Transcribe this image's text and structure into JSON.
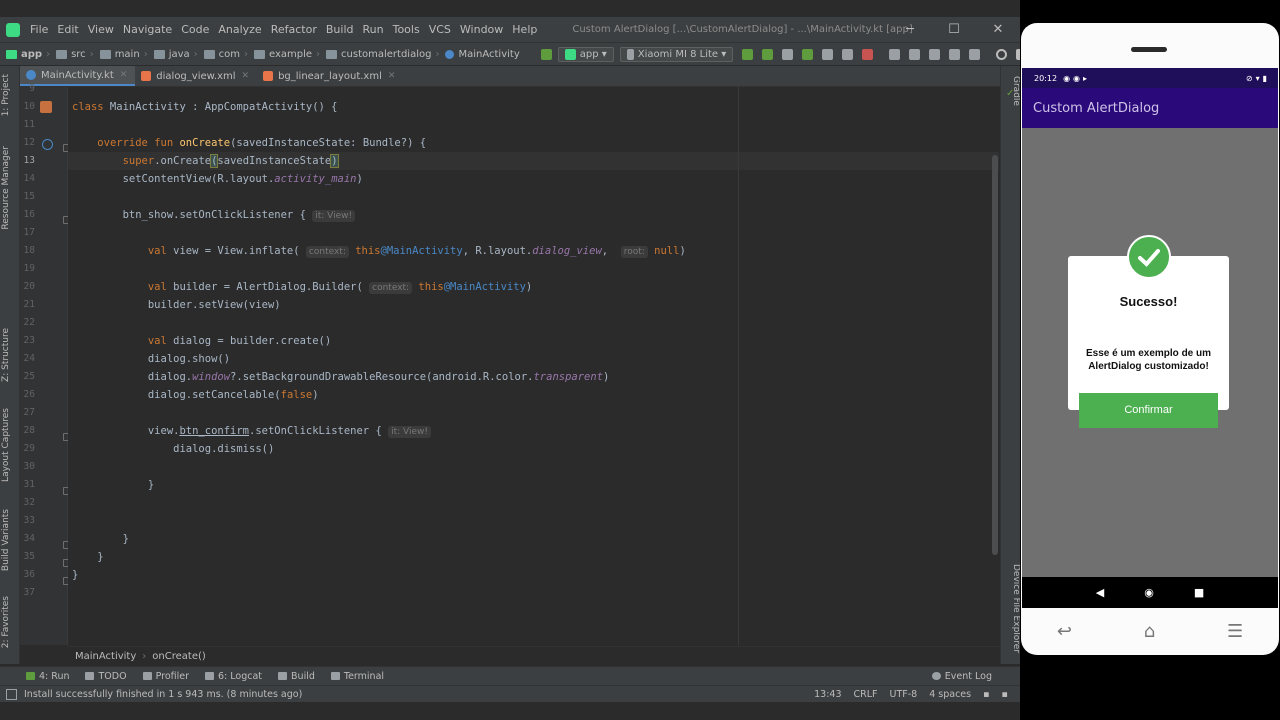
{
  "ide": {
    "menu": [
      "File",
      "Edit",
      "View",
      "Navigate",
      "Code",
      "Analyze",
      "Refactor",
      "Build",
      "Run",
      "Tools",
      "VCS",
      "Window",
      "Help"
    ],
    "window_title": "Custom AlertDialog [...\\CustomAlertDialog] - ...\\MainActivity.kt [app]",
    "breadcrumb": [
      "app",
      "src",
      "main",
      "java",
      "com",
      "example",
      "customalertdialog",
      "MainActivity"
    ],
    "run_config": "app",
    "device": "Xiaomi MI 8 Lite",
    "tabs": [
      "MainActivity.kt",
      "dialog_view.xml",
      "bg_linear_layout.xml"
    ],
    "left_tools": [
      "1: Project",
      "Resource Manager",
      "Z: Structure",
      "Layout Captures",
      "Build Variants",
      "2: Favorites"
    ],
    "right_tools": [
      "Gradle",
      "Device File Explorer"
    ],
    "line_numbers": [
      "9",
      "10",
      "11",
      "12",
      "13",
      "14",
      "15",
      "16",
      "17",
      "18",
      "19",
      "20",
      "21",
      "22",
      "23",
      "24",
      "25",
      "26",
      "27",
      "28",
      "29",
      "30",
      "31",
      "32",
      "33",
      "34",
      "35",
      "36",
      "37"
    ],
    "current_line": "13",
    "code_breadcrumb": [
      "MainActivity",
      "onCreate()"
    ],
    "tool_windows": [
      "4: Run",
      "TODO",
      "Profiler",
      "6: Logcat",
      "Build",
      "Terminal"
    ],
    "event_log": "Event Log",
    "status_message": "Install successfully finished in 1 s 943 ms. (8 minutes ago)",
    "status_right": [
      "13:43",
      "CRLF",
      "UTF-8",
      "4 spaces"
    ]
  },
  "phone": {
    "time": "20:12",
    "app_title": "Custom AlertDialog",
    "dialog_title": "Sucesso!",
    "dialog_message": "Esse é um exemplo de um AlertDialog customizado!",
    "confirm_label": "Confirmar"
  },
  "colors": {
    "accent": "#4a88c7",
    "success": "#4caf50",
    "app_bar": "#2a0a7a"
  }
}
